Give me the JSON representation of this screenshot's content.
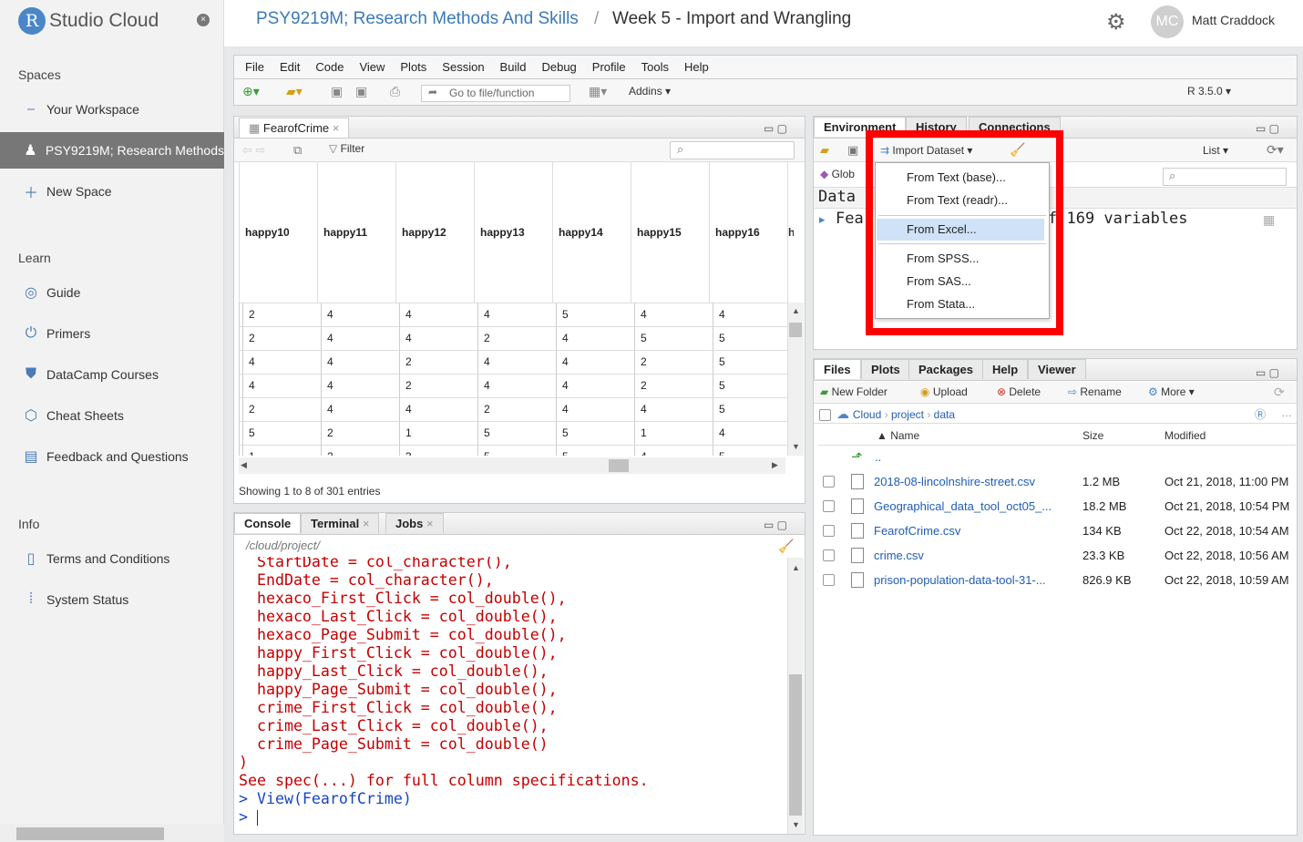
{
  "brand": {
    "logo_letter": "R",
    "logo_text": "Studio Cloud"
  },
  "sidebar": {
    "close_label": "×",
    "spaces_title": "Spaces",
    "spaces": [
      {
        "label": "Your Workspace",
        "icon": "workspace-icon"
      },
      {
        "label": "PSY9219M; Research Methods",
        "icon": "users-icon",
        "active": true
      },
      {
        "label": "New Space",
        "icon": "plus-icon"
      }
    ],
    "learn_title": "Learn",
    "learn": [
      {
        "label": "Guide",
        "icon": "compass-icon"
      },
      {
        "label": "Primers",
        "icon": "power-icon"
      },
      {
        "label": "DataCamp Courses",
        "icon": "shield-icon"
      },
      {
        "label": "Cheat Sheets",
        "icon": "hexagon-icon"
      },
      {
        "label": "Feedback and Questions",
        "icon": "chat-icon"
      }
    ],
    "info_title": "Info",
    "info": [
      {
        "label": "Terms and Conditions",
        "icon": "document-icon"
      },
      {
        "label": "System Status",
        "icon": "pulse-icon"
      }
    ]
  },
  "header": {
    "breadcrumb_space": "PSY9219M; Research Methods And Skills",
    "breadcrumb_sep": "/",
    "breadcrumb_project": "Week 5 - Import and Wrangling",
    "user_initials": "MC",
    "user_name": "Matt Craddock"
  },
  "menu": [
    "File",
    "Edit",
    "Code",
    "View",
    "Plots",
    "Session",
    "Build",
    "Debug",
    "Profile",
    "Tools",
    "Help"
  ],
  "toolbar": {
    "goto_placeholder": "Go to file/function",
    "addins": "Addins ▾",
    "r_version": "R 3.5.0 ▾"
  },
  "viewer": {
    "tab": "FearofCrime",
    "filter": "Filter",
    "columns": [
      "happy10",
      "happy11",
      "happy12",
      "happy13",
      "happy14",
      "happy15",
      "happy16",
      "ha"
    ],
    "rows": [
      [
        "2",
        "4",
        "4",
        "4",
        "5",
        "4",
        "4"
      ],
      [
        "2",
        "4",
        "4",
        "2",
        "4",
        "5",
        "5"
      ],
      [
        "4",
        "4",
        "2",
        "4",
        "4",
        "2",
        "5"
      ],
      [
        "4",
        "4",
        "2",
        "4",
        "4",
        "2",
        "5"
      ],
      [
        "2",
        "4",
        "4",
        "2",
        "4",
        "4",
        "5"
      ],
      [
        "5",
        "2",
        "1",
        "5",
        "5",
        "1",
        "4"
      ],
      [
        "1",
        "2",
        "3",
        "5",
        "5",
        "4",
        "5"
      ]
    ],
    "showing": "Showing 1 to 8 of 301 entries"
  },
  "console": {
    "tabs": [
      "Console",
      "Terminal",
      "Jobs"
    ],
    "path": "/cloud/project/",
    "lines": [
      "  StartDate = col_character(),",
      "  EndDate = col_character(),",
      "  hexaco_First_Click = col_double(),",
      "  hexaco_Last_Click = col_double(),",
      "  hexaco_Page_Submit = col_double(),",
      "  happy_First_Click = col_double(),",
      "  happy_Last_Click = col_double(),",
      "  happy_Page_Submit = col_double(),",
      "  crime_First_Click = col_double(),",
      "  crime_Last_Click = col_double(),",
      "  crime_Page_Submit = col_double()",
      ")",
      "See spec(...) for full column specifications."
    ],
    "input_line": "> View(FearofCrime)",
    "prompt": ">"
  },
  "env": {
    "tabs": [
      "Environment",
      "History",
      "Connections"
    ],
    "import_label": "Import Dataset ▾",
    "list_label": "List ▾",
    "global_label": "Glob",
    "data_header": "Data",
    "row_name": "Fear",
    "row_desc": "f 169 variables",
    "menu_items": [
      "From Text (base)...",
      "From Text (readr)...",
      "From Excel...",
      "From SPSS...",
      "From SAS...",
      "From Stata..."
    ]
  },
  "files": {
    "tabs": [
      "Files",
      "Plots",
      "Packages",
      "Help",
      "Viewer"
    ],
    "actions": [
      "New Folder",
      "Upload",
      "Delete",
      "Rename",
      "More ▾"
    ],
    "path": [
      "Cloud",
      "project",
      "data"
    ],
    "headers": [
      "▲ Name",
      "Size",
      "Modified"
    ],
    "up": "..",
    "rows": [
      {
        "name": "2018-08-lincolnshire-street.csv",
        "size": "1.2 MB",
        "modified": "Oct 21, 2018, 11:00 PM"
      },
      {
        "name": "Geographical_data_tool_oct05_...",
        "size": "18.2 MB",
        "modified": "Oct 21, 2018, 10:54 PM"
      },
      {
        "name": "FearofCrime.csv",
        "size": "134 KB",
        "modified": "Oct 22, 2018, 10:54 AM"
      },
      {
        "name": "crime.csv",
        "size": "23.3 KB",
        "modified": "Oct 22, 2018, 10:56 AM"
      },
      {
        "name": "prison-population-data-tool-31-...",
        "size": "826.9 KB",
        "modified": "Oct 22, 2018, 10:59 AM"
      }
    ]
  },
  "colors": {
    "accent": "#3a7ab8",
    "highlight": "#ff0000",
    "console_red": "#c40000"
  }
}
